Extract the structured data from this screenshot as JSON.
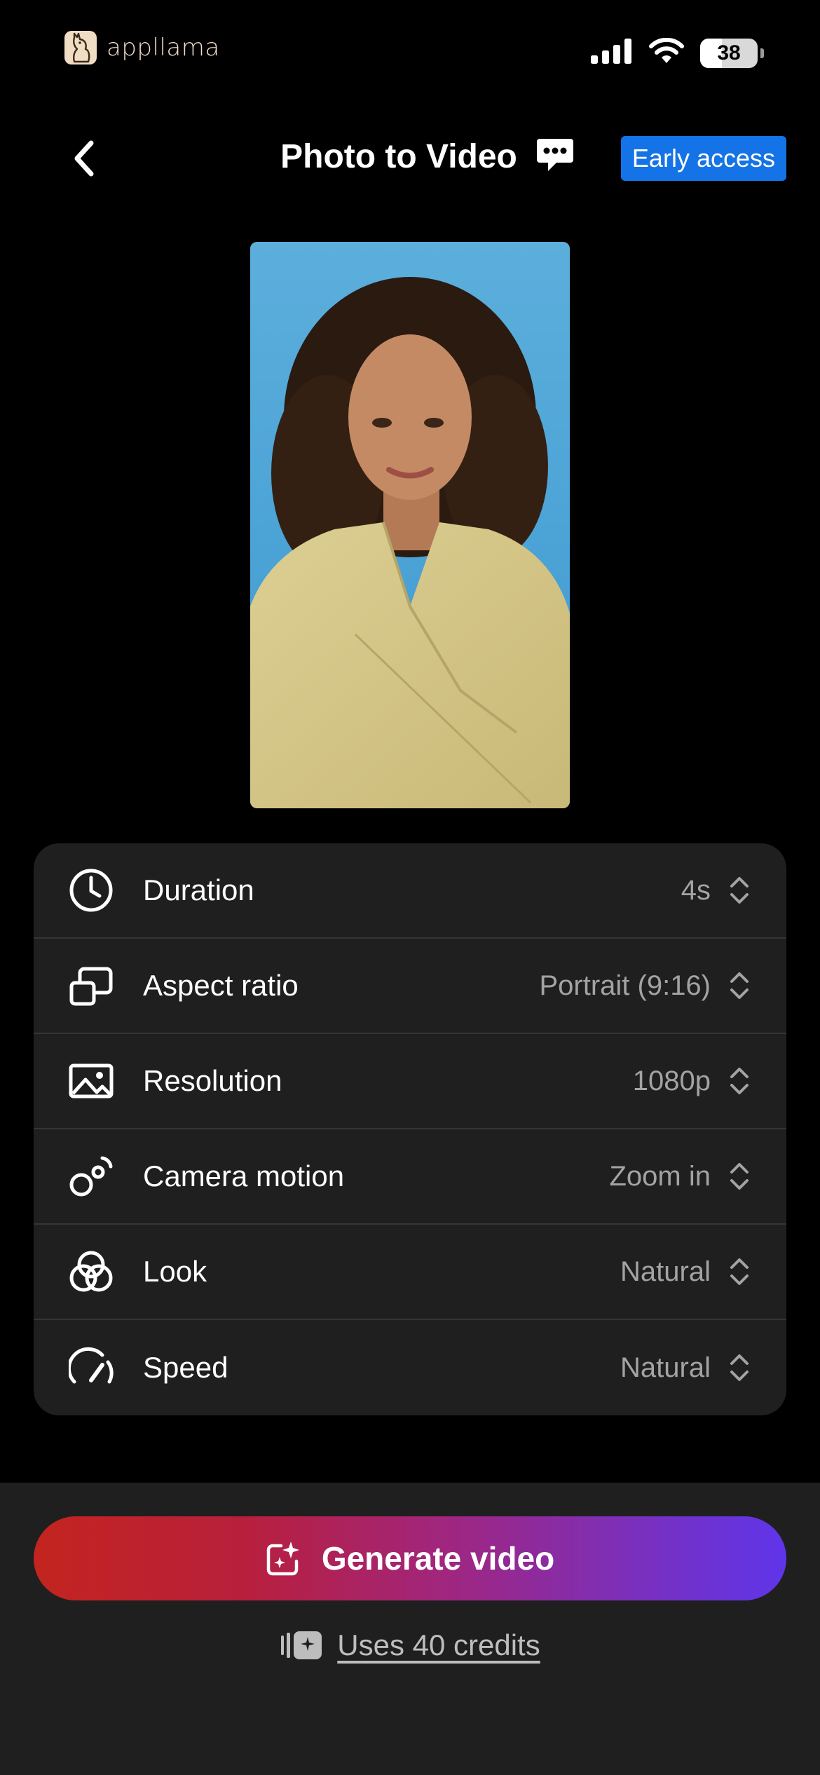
{
  "status_bar": {
    "logo_text": "appllama",
    "battery_level": "38"
  },
  "header": {
    "title": "Photo to Video",
    "badge": "Early access"
  },
  "settings": [
    {
      "label": "Duration",
      "value": "4s",
      "icon": "clock-icon"
    },
    {
      "label": "Aspect ratio",
      "value": "Portrait (9:16)",
      "icon": "aspect-ratio-icon"
    },
    {
      "label": "Resolution",
      "value": "1080p",
      "icon": "image-icon"
    },
    {
      "label": "Camera motion",
      "value": "Zoom in",
      "icon": "camera-motion-icon"
    },
    {
      "label": "Look",
      "value": "Natural",
      "icon": "look-icon"
    },
    {
      "label": "Speed",
      "value": "Natural",
      "icon": "speedometer-icon"
    }
  ],
  "actions": {
    "generate_label": "Generate video",
    "credits_text": "Uses 40 credits"
  },
  "colors": {
    "badge": "#1473e6",
    "card_bg": "#1f1f1f",
    "gradient_start": "#c3241f",
    "gradient_end": "#5f35ea"
  }
}
